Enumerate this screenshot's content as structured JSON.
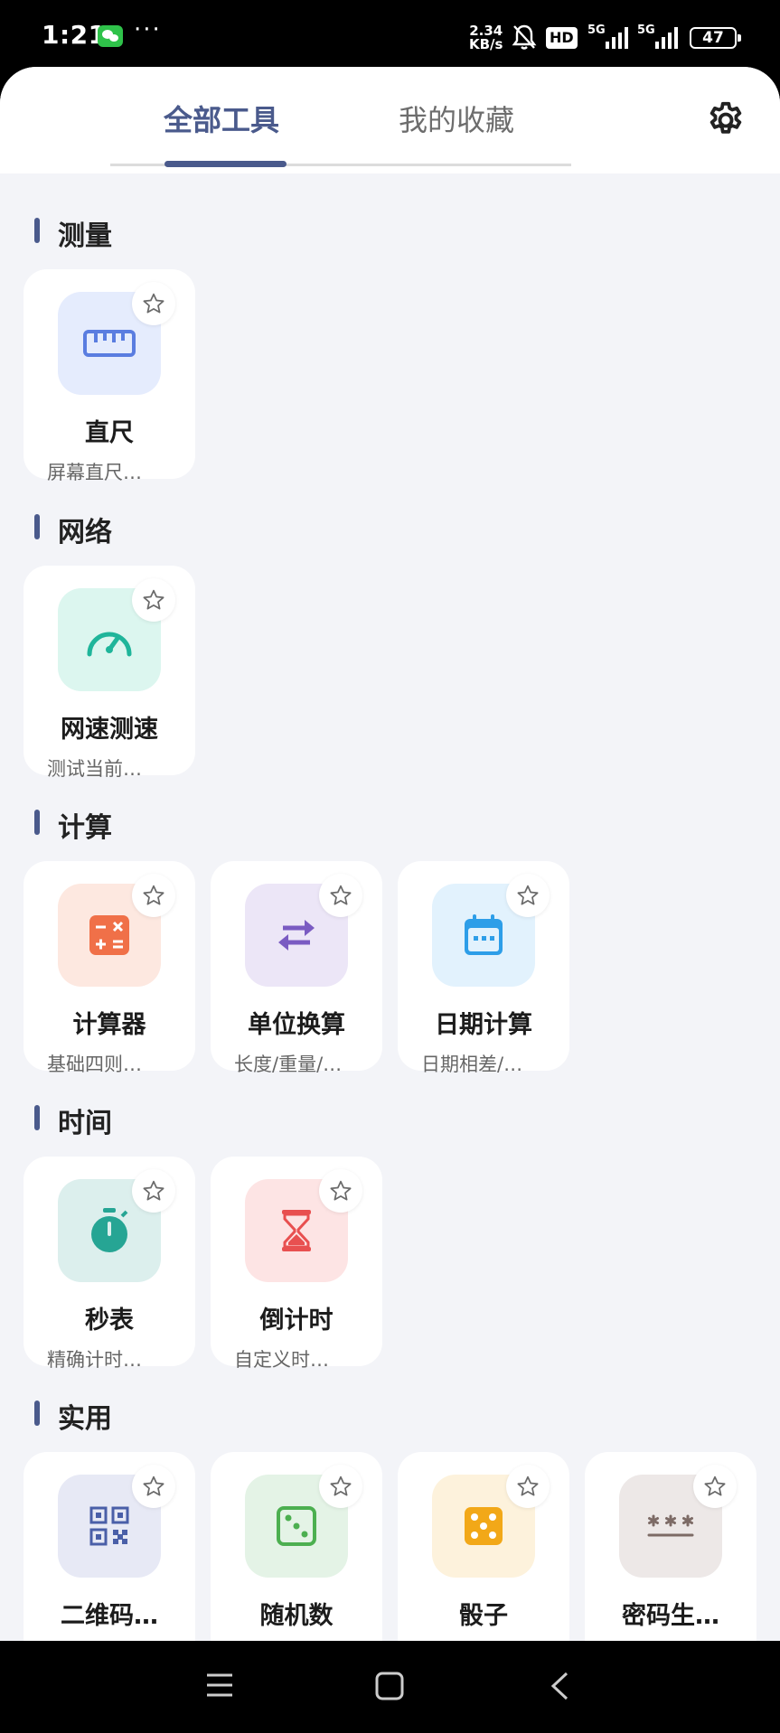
{
  "status": {
    "time": "1:21",
    "dots": "···",
    "speed_value": "2.34",
    "speed_unit": "KB/s",
    "hd": "HD",
    "net1": "5G",
    "net2": "5G",
    "battery": "47"
  },
  "tabs": {
    "all": "全部工具",
    "favorites": "我的收藏"
  },
  "sections": {
    "measure": {
      "title": "测量",
      "items": [
        {
          "name": "直尺",
          "desc": "屏幕直尺…",
          "icon": "ruler-icon",
          "color": "#5a7de0",
          "bg": "#e5ecfd"
        }
      ]
    },
    "network": {
      "title": "网络",
      "items": [
        {
          "name": "网速测速",
          "desc": "测试当前…",
          "icon": "speedometer-icon",
          "color": "#1fb59a",
          "bg": "#dcf6ef"
        }
      ]
    },
    "calc": {
      "title": "计算",
      "items": [
        {
          "name": "计算器",
          "desc": "基础四则…",
          "icon": "calculator-icon",
          "color": "#f07048",
          "bg": "#fde8e0"
        },
        {
          "name": "单位换算",
          "desc": "长度/重量/…",
          "icon": "swap-arrows-icon",
          "color": "#7a5bc2",
          "bg": "#ece6f7"
        },
        {
          "name": "日期计算",
          "desc": "日期相差/…",
          "icon": "calendar-icon",
          "color": "#2d9ee8",
          "bg": "#e2f2fd"
        }
      ]
    },
    "time": {
      "title": "时间",
      "items": [
        {
          "name": "秒表",
          "desc": "精确计时…",
          "icon": "stopwatch-icon",
          "color": "#26a594",
          "bg": "#dcefed"
        },
        {
          "name": "倒计时",
          "desc": "自定义时…",
          "icon": "hourglass-icon",
          "color": "#e85050",
          "bg": "#fde4e4"
        }
      ]
    },
    "util": {
      "title": "实用",
      "items": [
        {
          "name": "二维码…",
          "icon": "qr-code-icon",
          "color": "#4a5fa8",
          "bg": "#e7e9f5"
        },
        {
          "name": "随机数",
          "icon": "dice-icon",
          "color": "#4caf50",
          "bg": "#e4f3e6"
        },
        {
          "name": "骰子",
          "icon": "dice-icon",
          "color": "#f2a818",
          "bg": "#fdf2dc"
        },
        {
          "name": "密码生…",
          "icon": "password-icon",
          "color": "#7d6b66",
          "bg": "#ede8e7"
        }
      ]
    }
  }
}
